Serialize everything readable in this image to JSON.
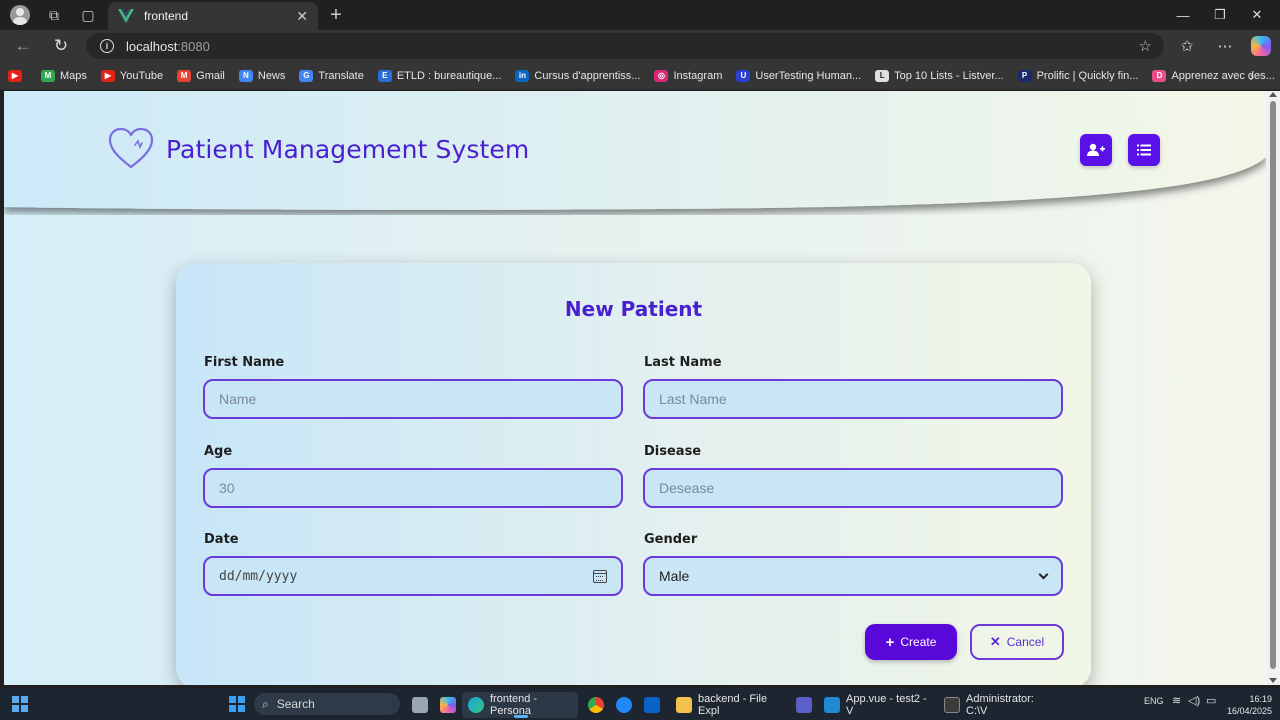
{
  "browser": {
    "tab_title": "frontend",
    "url_host": "localhost",
    "url_port": ":8080",
    "bookmarks": [
      {
        "label": "",
        "color": "#e62117",
        "glyph": "▶"
      },
      {
        "label": "Maps",
        "color": "#34a853",
        "glyph": "M"
      },
      {
        "label": "YouTube",
        "color": "#e62117",
        "glyph": "▶"
      },
      {
        "label": "Gmail",
        "color": "#ea4335",
        "glyph": "M"
      },
      {
        "label": "News",
        "color": "#4285f4",
        "glyph": "N"
      },
      {
        "label": "Translate",
        "color": "#4285f4",
        "glyph": "G"
      },
      {
        "label": "ETLD : bureautique...",
        "color": "#2a6fd6",
        "glyph": "E"
      },
      {
        "label": "Cursus d'apprentiss...",
        "color": "#0a66c2",
        "glyph": "in"
      },
      {
        "label": "Instagram",
        "color": "#d62976",
        "glyph": "◎"
      },
      {
        "label": "UserTesting Human...",
        "color": "#2b3fd1",
        "glyph": "U"
      },
      {
        "label": "Top 10 Lists - Listver...",
        "color": "#e0e0e0",
        "glyph": "L"
      },
      {
        "label": "Prolific | Quickly fin...",
        "color": "#1b2a6b",
        "glyph": "P"
      },
      {
        "label": "Apprenez avec des...",
        "color": "#e94d8a",
        "glyph": "D"
      }
    ]
  },
  "app": {
    "title": "Patient Management System",
    "accent": "#5a10e8"
  },
  "form": {
    "title": "New Patient",
    "first_name_label": "First Name",
    "first_name_placeholder": "Name",
    "last_name_label": "Last Name",
    "last_name_placeholder": "Last Name",
    "age_label": "Age",
    "age_placeholder": "30",
    "disease_label": "Disease",
    "disease_placeholder": "Desease",
    "date_label": "Date",
    "date_placeholder": "dd/mm/yyyy",
    "gender_label": "Gender",
    "gender_value": "Male",
    "create_label": "Create",
    "cancel_label": "Cancel"
  },
  "taskbar": {
    "search": "Search",
    "apps": [
      {
        "label": "frontend - Persona"
      },
      {
        "label": "backend - File Expl"
      },
      {
        "label": "App.vue - test2 - V"
      },
      {
        "label": "Administrator: C:\\V"
      }
    ],
    "lang": "ENG",
    "time": "16:19",
    "date": "16/04/2025"
  }
}
